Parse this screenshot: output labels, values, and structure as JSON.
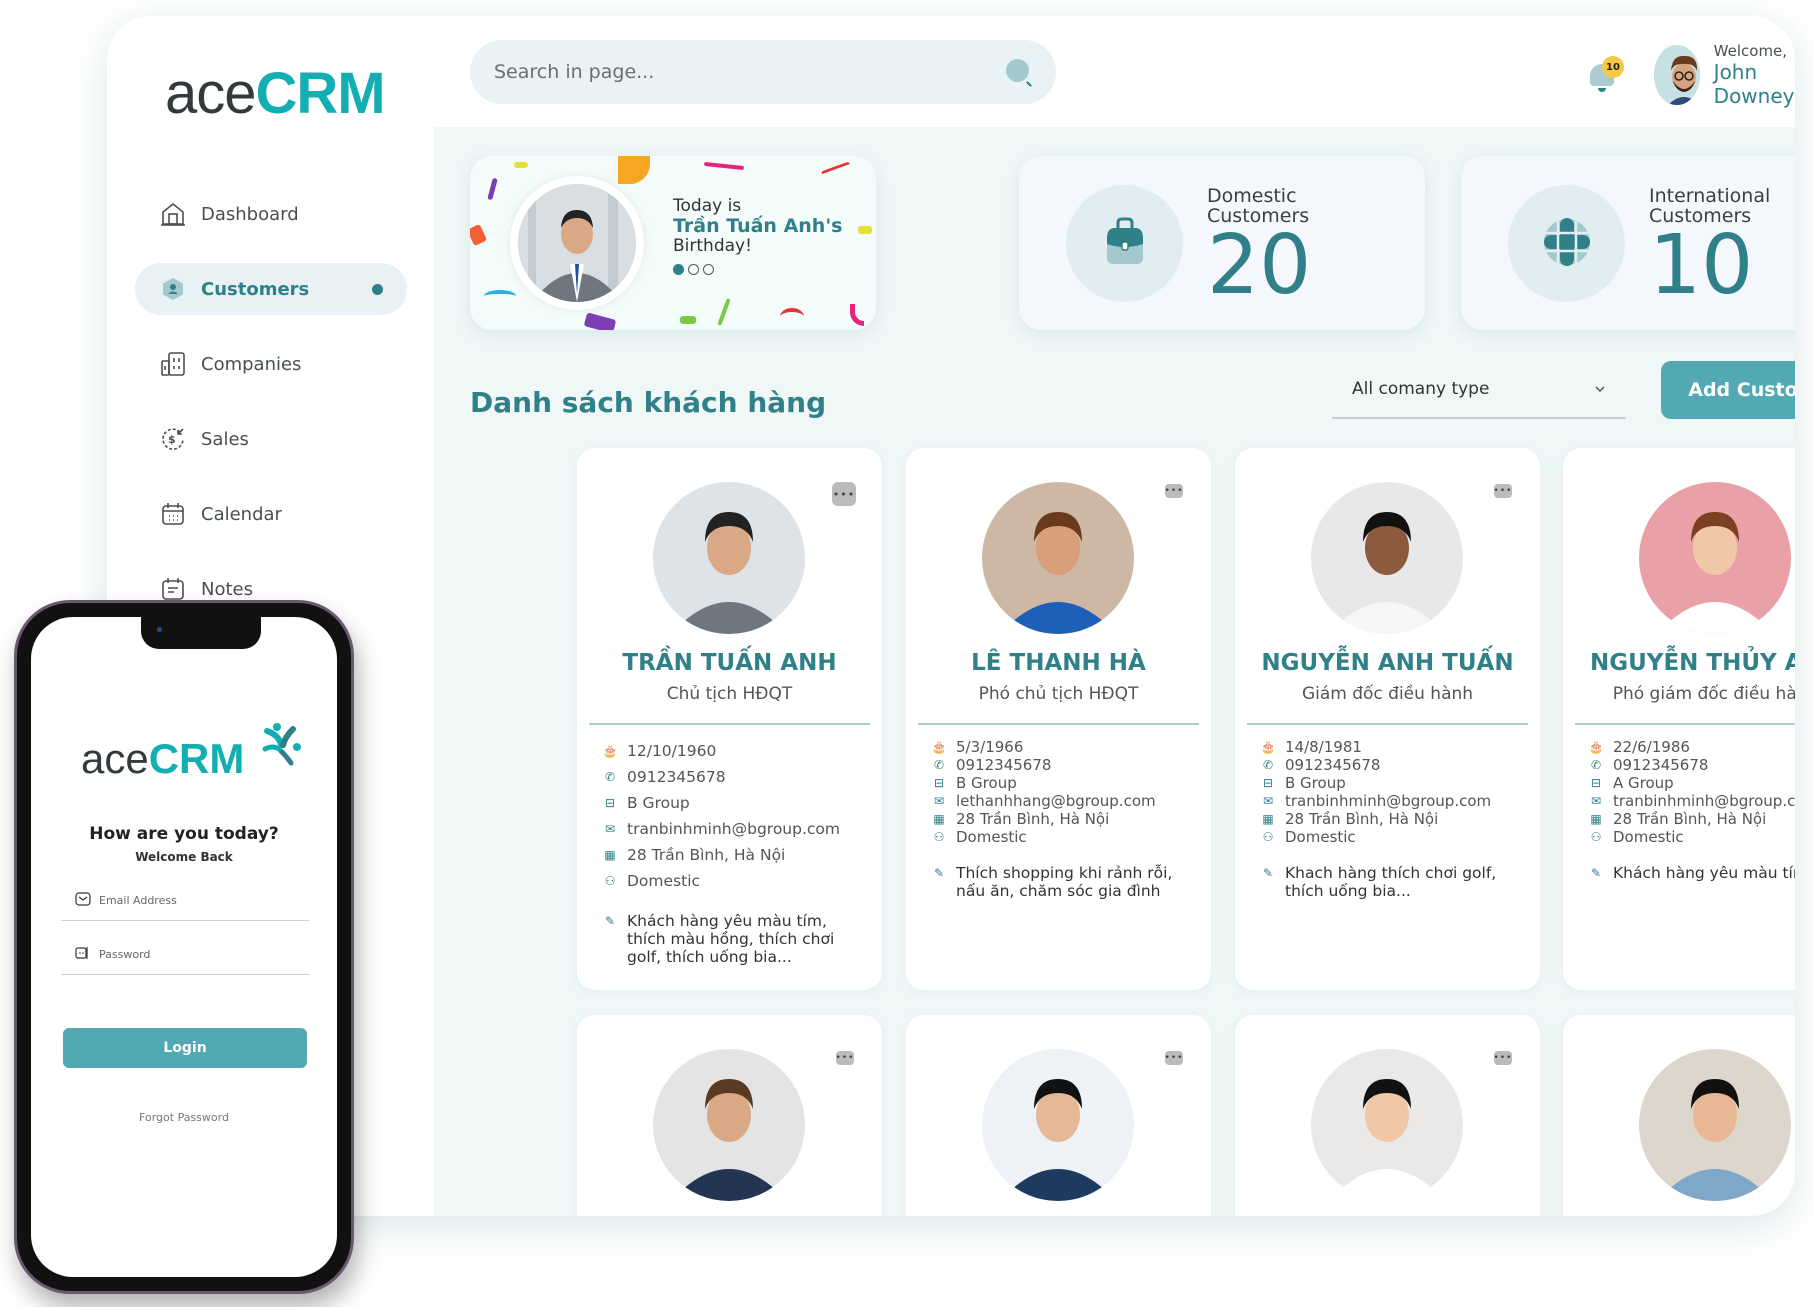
{
  "brand": {
    "ace": "ace",
    "crm": "CRM"
  },
  "colors": {
    "primary": "#2f8088",
    "accent": "#13aeb2",
    "button": "#52a9b3",
    "badge": "#f6c843"
  },
  "sidebar": {
    "items": [
      {
        "label": "Dashboard",
        "icon": "home-icon",
        "active": false
      },
      {
        "label": "Customers",
        "icon": "customer-icon",
        "active": true
      },
      {
        "label": "Companies",
        "icon": "building-icon",
        "active": false
      },
      {
        "label": "Sales",
        "icon": "dollar-icon",
        "active": false
      },
      {
        "label": "Calendar",
        "icon": "calendar-icon",
        "active": false
      },
      {
        "label": "Notes",
        "icon": "notes-icon",
        "active": false
      }
    ]
  },
  "header": {
    "search_placeholder": "Search in page...",
    "notification_count": "10",
    "welcome": "Welcome,",
    "user_name": "John Downey"
  },
  "birthday": {
    "line1": "Today is",
    "name": "Trần Tuấn Anh's",
    "line3": "Birthday!",
    "slide_index": 1,
    "slide_count": 3
  },
  "stats": [
    {
      "label_line1": "Domestic",
      "label_line2": "Customers",
      "value": "20",
      "icon": "briefcase-icon"
    },
    {
      "label_line1": "International",
      "label_line2": "Customers",
      "value": "10",
      "icon": "globe-icon"
    }
  ],
  "list": {
    "title": "Danh sách khách hàng",
    "filter_value": "All comany type",
    "add_button": "Add Customer"
  },
  "customers": [
    {
      "name": "TRẦN TUẤN ANH",
      "title": "Chủ tịch HĐQT",
      "birthday": "12/10/1960",
      "phone": "0912345678",
      "company": "B Group",
      "email": "tranbinhminh@bgroup.com",
      "address": "28 Trần Bình, Hà Nội",
      "type": "Domestic",
      "note": "Khách hàng yêu màu tím, thích màu hồng, thích chơi golf, thích uống bia..."
    },
    {
      "name": "LÊ THANH HÀ",
      "title": "Phó chủ tịch HĐQT",
      "birthday": "5/3/1966",
      "phone": "0912345678",
      "company": "B Group",
      "email": "lethanhhang@bgroup.com",
      "address": "28 Trần Bình, Hà Nội",
      "type": "Domestic",
      "note": "Thích shopping khi rảnh rỗi, nấu ăn, chăm sóc gia đình"
    },
    {
      "name": "NGUYỄN ANH TUẤN",
      "title": "Giám đốc điều hành",
      "birthday": "14/8/1981",
      "phone": "0912345678",
      "company": "B Group",
      "email": "tranbinhminh@bgroup.com",
      "address": "28 Trần Bình, Hà Nội",
      "type": "Domestic",
      "note": "Khach hàng thích chơi golf, thích uống bia..."
    },
    {
      "name": "NGUYỄN THỦY ANH",
      "title": "Phó giám đốc điều hành",
      "birthday": "22/6/1986",
      "phone": "0912345678",
      "company": "A Group",
      "email": "tranbinhminh@bgroup.com",
      "address": "28 Trần Bình, Hà Nội",
      "type": "Domestic",
      "note": "Khách hàng yêu màu tím"
    }
  ],
  "more_label": "•••",
  "phone": {
    "greeting": "How are you today?",
    "subtitle": "Welcome Back",
    "email_placeholder": "Email Address",
    "password_placeholder": "Password",
    "login_button": "Login",
    "forgot_password": "Forgot Password"
  }
}
